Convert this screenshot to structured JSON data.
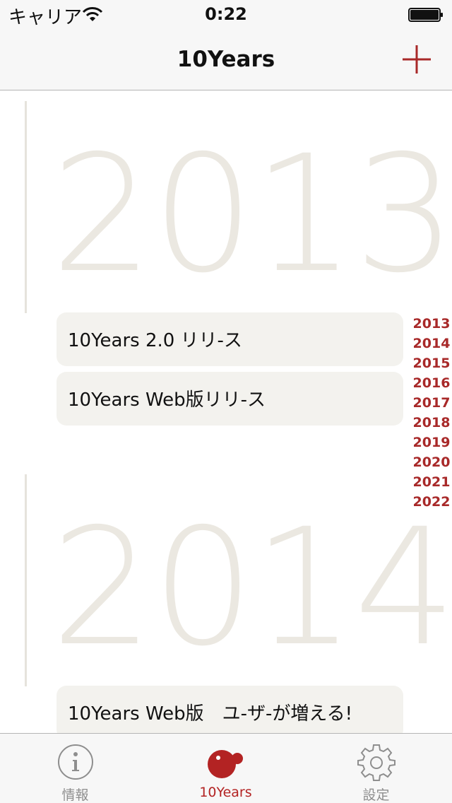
{
  "status_bar": {
    "carrier": "キャリア",
    "time": "0:22"
  },
  "nav": {
    "title": "10Years",
    "add_icon": "plus-icon"
  },
  "sections": [
    {
      "year": "2013",
      "events": [
        "10Years 2.0 リリ-ス",
        "10Years Web版リリ-ス"
      ]
    },
    {
      "year": "2014",
      "events": [
        "10Years Web版　ユ-ザ-が増える!"
      ]
    }
  ],
  "year_index": [
    "2013",
    "2014",
    "2015",
    "2016",
    "2017",
    "2018",
    "2019",
    "2020",
    "2021",
    "2022"
  ],
  "tabs": [
    {
      "label": "情報",
      "icon": "info-icon"
    },
    {
      "label": "10Years",
      "icon": "10years-logo-icon"
    },
    {
      "label": "設定",
      "icon": "gear-icon"
    }
  ],
  "colors": {
    "accent": "#a82929",
    "year_number": "#ebe8e1",
    "card_bg": "#f3f2ee",
    "tab_inactive": "#8e8e8e"
  }
}
